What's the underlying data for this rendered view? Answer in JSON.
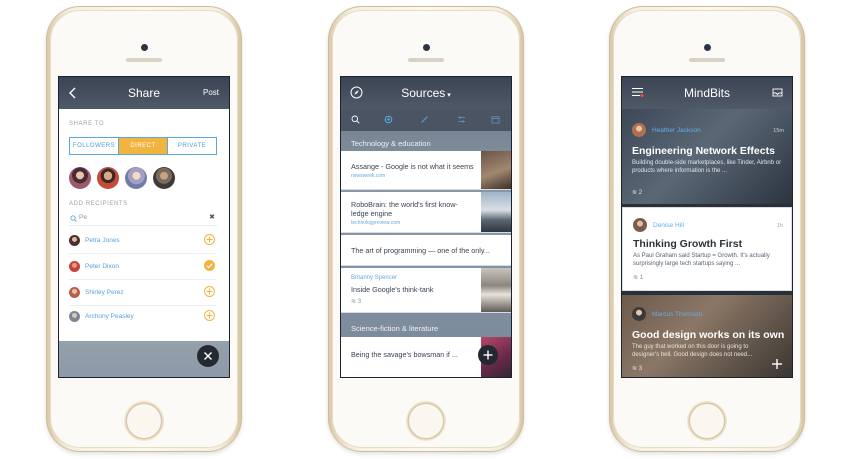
{
  "colors": {
    "accent_gold": "#f2b441",
    "accent_blue": "#5aa8dd",
    "header_dark": "#3a4452"
  },
  "share": {
    "title": "Share",
    "post_label": "Post",
    "share_to_label": "SHARE TO",
    "segments": [
      "FOLLOWERS",
      "DIRECT",
      "PRIVATE"
    ],
    "selected_segment": "DIRECT",
    "add_recipients_label": "ADD RECIPIENTS",
    "search_value": "Pe",
    "recipients": [
      {
        "name": "Petra Jones",
        "selected": false
      },
      {
        "name": "Peter Dixon",
        "selected": true
      },
      {
        "name": "Shirley Perez",
        "selected": false
      },
      {
        "name": "Archony Peasley",
        "selected": false
      }
    ]
  },
  "sources": {
    "title": "Sources",
    "categories": [
      "Technology & education",
      "Science-fiction & literature"
    ],
    "items": [
      {
        "title": "Assange - Google is not what it seems",
        "url": "newsweek.com"
      },
      {
        "title": "RoboBrain: the world's first know-ledge engine",
        "url": "technologyreview.com"
      },
      {
        "title": "The art of programming — one of the only..."
      },
      {
        "author": "Britanny Spencer",
        "title": "Inside Google's think-tank",
        "count": "3"
      },
      {
        "title": "Being the savage's bowsman if ..."
      }
    ]
  },
  "mindbits": {
    "title": "MindBits",
    "cards": [
      {
        "author": "Heather Jackson",
        "time": "15m",
        "headline": "Engineering Network Effects",
        "excerpt": "Building double-side marketplaces, like Tinder, Airbnb or products where information is the ...",
        "count": "2"
      },
      {
        "author": "Denise Hill",
        "time": "1h",
        "headline": "Thinking Growth First",
        "excerpt": "As Paul Graham said  Startup = Growth. It's actually surprisingly large tech startups saying ...",
        "count": "1"
      },
      {
        "author": "Marcus Thomson",
        "time": "",
        "headline": "Good design works on its own",
        "excerpt": "The guy that worked on this door is going to designer's hell. Good design does not need...",
        "count": "3"
      }
    ]
  }
}
